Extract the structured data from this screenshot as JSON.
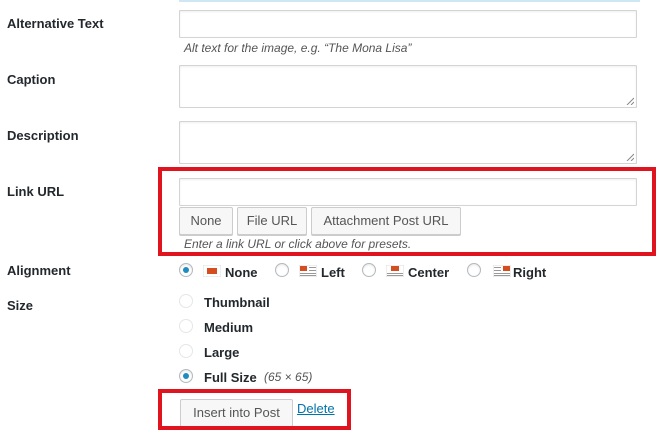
{
  "fields": {
    "alt_text": {
      "label": "Alternative Text",
      "value": "",
      "hint": "Alt text for the image, e.g. “The Mona Lisa”"
    },
    "caption": {
      "label": "Caption",
      "value": ""
    },
    "description": {
      "label": "Description",
      "value": ""
    },
    "link_url": {
      "label": "Link URL",
      "value": "",
      "buttons": {
        "none": "None",
        "file": "File URL",
        "attachment": "Attachment Post URL"
      },
      "hint": "Enter a link URL or click above for presets."
    }
  },
  "alignment": {
    "label": "Alignment",
    "selected": "None",
    "options": {
      "none": "None",
      "left": "Left",
      "center": "Center",
      "right": "Right"
    }
  },
  "size": {
    "label": "Size",
    "selected": "Full Size",
    "options": {
      "thumbnail": "Thumbnail",
      "medium": "Medium",
      "large": "Large",
      "full": "Full Size"
    },
    "full_dimensions": "(65 × 65)"
  },
  "actions": {
    "insert": "Insert into Post",
    "delete": "Delete"
  },
  "colors": {
    "highlight": "#e0141e",
    "link": "#0073aa",
    "radio_checked": "#1e8cbe",
    "icon_accent": "#d54e21"
  }
}
